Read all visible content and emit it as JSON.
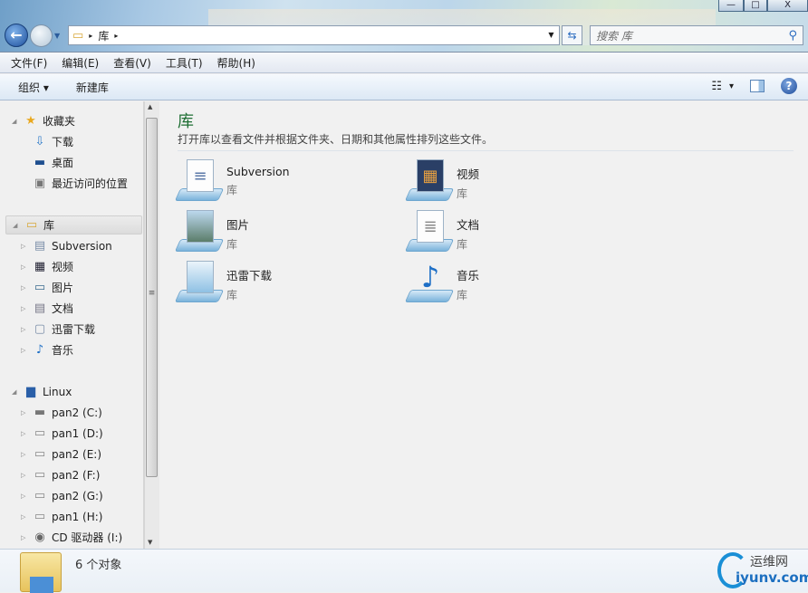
{
  "window": {
    "minimize": "—",
    "maximize": "□",
    "close": "X"
  },
  "address": {
    "crumbs": [
      "库"
    ],
    "arrow": "▸"
  },
  "search": {
    "placeholder": "搜索 库"
  },
  "menu": [
    "文件(F)",
    "编辑(E)",
    "查看(V)",
    "工具(T)",
    "帮助(H)"
  ],
  "toolbar": {
    "organize": "组织 ▾",
    "new_library": "新建库",
    "view_dd": "▾",
    "help": "?"
  },
  "nav": {
    "favorites": {
      "label": "收藏夹",
      "items": [
        "下载",
        "桌面",
        "最近访问的位置"
      ]
    },
    "libraries": {
      "label": "库",
      "items": [
        "Subversion",
        "视频",
        "图片",
        "文档",
        "迅雷下载",
        "音乐"
      ]
    },
    "computer": {
      "label": "Linux",
      "items": [
        "pan2 (C:)",
        "pan1 (D:)",
        "pan2 (E:)",
        "pan2 (F:)",
        "pan2 (G:)",
        "pan1 (H:)",
        "CD 驱动器 (I:)"
      ]
    }
  },
  "content": {
    "title": "库",
    "description": "打开库以查看文件并根据文件夹、日期和其他属性排列这些文件。",
    "libraries": [
      {
        "name": "Subversion",
        "type": "库",
        "icon": "document-library-icon"
      },
      {
        "name": "视频",
        "type": "库",
        "icon": "video-library-icon"
      },
      {
        "name": "图片",
        "type": "库",
        "icon": "pictures-library-icon"
      },
      {
        "name": "文档",
        "type": "库",
        "icon": "documents-library-icon"
      },
      {
        "name": "迅雷下载",
        "type": "库",
        "icon": "download-library-icon"
      },
      {
        "name": "音乐",
        "type": "库",
        "icon": "music-library-icon"
      }
    ]
  },
  "status": {
    "count": "6 个对象"
  },
  "watermark": {
    "cn": "运维网",
    "en": "iyunv.com"
  }
}
